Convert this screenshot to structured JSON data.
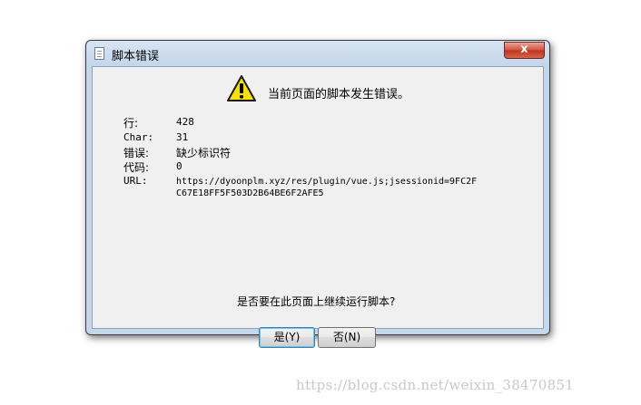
{
  "window": {
    "title": "脚本错误",
    "close_glyph": "x"
  },
  "dialog": {
    "message": "当前页面的脚本发生错误。",
    "fields": [
      {
        "label": "行:",
        "value": "428"
      },
      {
        "label": "Char:",
        "value": "31"
      },
      {
        "label": "错误:",
        "value": "缺少标识符"
      },
      {
        "label": "代码:",
        "value": "0"
      },
      {
        "label": "URL:",
        "value_line1": "https://dyoonplm.xyz/res/plugin/vue.js;jsessionid=9FC2F",
        "value_line2": "C67E18FF5F503D2B64BE6F2AFE5"
      }
    ],
    "question": "是否要在此页面上继续运行脚本?",
    "yes_label": "是(Y)",
    "no_label": "否(N)"
  },
  "watermark": "https://blog.csdn.net/weixin_38470851",
  "icons": {
    "warning": "warning-icon",
    "document": "document-icon",
    "close": "close-icon"
  }
}
